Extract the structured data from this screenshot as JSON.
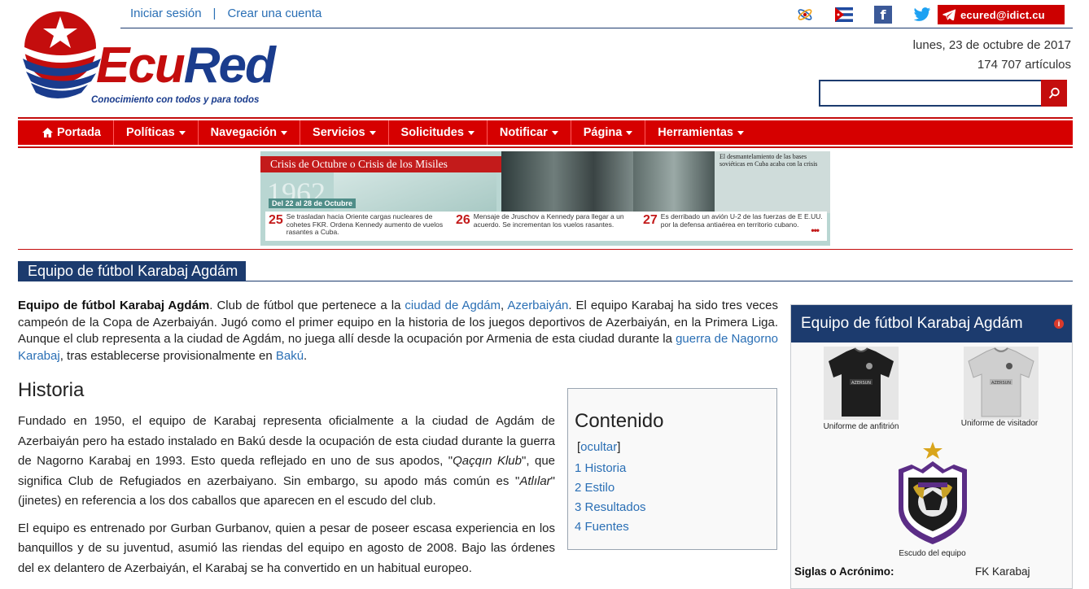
{
  "account": {
    "login": "Iniciar sesión",
    "separator": "|",
    "create": "Crear una cuenta"
  },
  "social": {
    "email": "ecured@idict.cu",
    "icons": [
      "atom-icon",
      "cuba-flag-icon",
      "facebook-icon",
      "twitter-icon",
      "telegram-icon"
    ]
  },
  "logo": {
    "ecu": "Ecu",
    "red": "Red",
    "tagline": "Conocimiento con todos y para todos"
  },
  "header": {
    "date": "lunes, 23 de octubre de 2017",
    "articles": "174 707 artículos"
  },
  "search": {
    "placeholder": "",
    "icon": "search-icon"
  },
  "nav": {
    "items": [
      {
        "label": "Portada",
        "icon": "home-icon",
        "caret": false
      },
      {
        "label": "Políticas",
        "caret": true
      },
      {
        "label": "Navegación",
        "caret": true
      },
      {
        "label": "Servicios",
        "caret": true
      },
      {
        "label": "Solicitudes",
        "caret": true
      },
      {
        "label": "Notificar",
        "caret": true
      },
      {
        "label": "Página",
        "caret": true
      },
      {
        "label": "Herramientas",
        "caret": true
      }
    ]
  },
  "banner": {
    "title": "Crisis de Octubre o Crisis de los Misiles",
    "year": "1962",
    "range": "Del 22 al 28 de Octubre",
    "headline": "El desmantelamiento de las bases soviéticas en Cuba acaba con la crisis",
    "events": [
      {
        "day": "25",
        "text": "Se trasladan hacia Oriente cargas nucleares de cohetes FKR. Ordena Kennedy aumento de vuelos rasantes a Cuba."
      },
      {
        "day": "26",
        "text": "Mensaje de Jruschov a Kennedy para llegar a un acuerdo. Se incrementan los vuelos rasantes."
      },
      {
        "day": "27",
        "text": "Es derribado un avión U-2 de las fuerzas de E E.UU. por la defensa antiaérea en territorio cubano."
      }
    ],
    "more": "•••"
  },
  "page": {
    "title": "Equipo de fútbol Karabaj Agdám"
  },
  "intro": {
    "bold": "Equipo de fútbol Karabaj Agdám",
    "t1": ". Club de fútbol que pertenece a la ",
    "link1": "ciudad de Agdám",
    "t2": ", ",
    "link2": "Azerbaiyán",
    "t3": ". El equipo Karabaj ha sido tres veces campeón de la Copa de Azerbaiyán. Jugó como el primer equipo en la historia de los juegos deportivos de Azerbaiyán, en la Primera Liga. Aunque el club representa a la ciudad de Agdám, no juega allí desde la ocupación por Armenia de esta ciudad durante la ",
    "link3": "guerra de Nagorno Karabaj",
    "t4": ", tras establecerse provisionalmente en ",
    "link4": "Bakú",
    "t5": "."
  },
  "historia": {
    "heading": "Historia",
    "p1a": "Fundado en 1950, el equipo de Karabaj representa oficialmente a la ciudad de Agdám de Azerbaiyán pero ha estado instalado en Bakú desde la ocupación de esta ciudad durante la guerra de Nagorno Karabaj en 1993. Esto queda reflejado en uno de sus apodos, \"",
    "p1i1": "Qaçqın Klub",
    "p1b": "\", que significa Club de Refugiados en azerbaiyano. Sin embargo, su apodo más común es \"",
    "p1i2": "Atlılar",
    "p1c": "\" (jinetes) en referencia a los dos caballos que aparecen en el escudo del club.",
    "p2": "El equipo es entrenado por Gurban Gurbanov, quien a pesar de poseer escasa experiencia en los banquillos y de su juventud, asumió las riendas del equipo en agosto de 2008. Bajo las órdenes del ex delantero de Azerbaiyán, el Karabaj se ha convertido en un habitual europeo."
  },
  "toc": {
    "title": "Contenido",
    "toggle_open": "[",
    "toggle": "ocultar",
    "toggle_close": "]",
    "items": [
      "1 Historia",
      "2 Estilo",
      "3 Resultados",
      "4 Fuentes"
    ]
  },
  "infobox": {
    "title": "Equipo de fútbol Karabaj Agdám",
    "home_kit": "Uniforme de anfitrión",
    "away_kit": "Uniforme de visitador",
    "crest": "Escudo del equipo",
    "kit_text": "AZERSUN",
    "rows": [
      {
        "key": "Siglas o Acrónimo:",
        "value": "FK Karabaj"
      }
    ]
  },
  "colors": {
    "brand_red": "#d60000",
    "brand_blue": "#1c3b6e",
    "link": "#2a6fb5"
  }
}
